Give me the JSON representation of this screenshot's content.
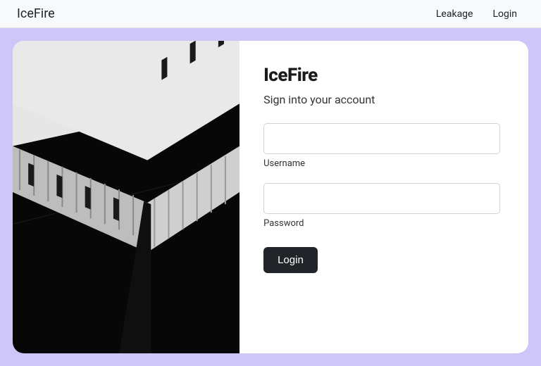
{
  "nav": {
    "brand": "IceFire",
    "links": {
      "leakage": "Leakage",
      "login": "Login"
    }
  },
  "login": {
    "logo": "IceFire",
    "subtitle": "Sign into your account",
    "username": {
      "value": "",
      "placeholder": "",
      "label": "Username"
    },
    "password": {
      "value": "",
      "placeholder": "",
      "label": "Password"
    },
    "button": "Login"
  },
  "colors": {
    "stage_bg": "#cdc6f7",
    "button_bg": "#212529"
  }
}
